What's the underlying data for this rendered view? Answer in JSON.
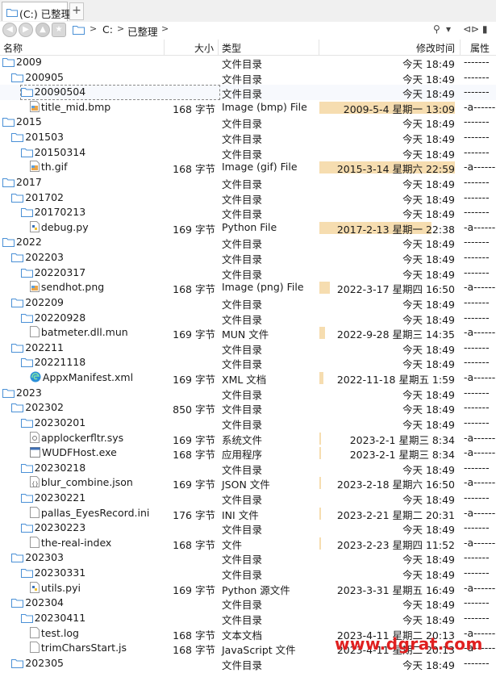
{
  "tab": {
    "title": "(C:) 已整理",
    "new_tab_label": "+"
  },
  "breadcrumb": {
    "items": [
      "C:",
      "已整理"
    ],
    "separator": ">"
  },
  "nav_right": {
    "search_glyph": "⚲",
    "dropdown_glyph": "▾",
    "misc_glyph": "⊲⊳ ▮"
  },
  "columns": {
    "name": "名称",
    "size": "大小",
    "type": "类型",
    "modified": "修改时间",
    "attr": "属性"
  },
  "colors": {
    "date_highlight": "#f6ddb0",
    "folder": "#4a90d6",
    "watermark": "#e02020"
  },
  "rows": [
    {
      "name": "2009",
      "level": 0,
      "icon": "folder",
      "size": "",
      "type": "文件目录",
      "date": "今天  18:49",
      "hl": 0,
      "attr": "-------"
    },
    {
      "name": "200905",
      "level": 1,
      "icon": "folder",
      "size": "",
      "type": "文件目录",
      "date": "今天  18:49",
      "hl": 0,
      "attr": "-------"
    },
    {
      "name": "20090504",
      "level": 2,
      "icon": "folder",
      "size": "",
      "type": "文件目录",
      "date": "今天  18:49",
      "hl": 0,
      "attr": "-------"
    },
    {
      "name": "title_mid.bmp",
      "level": 3,
      "icon": "image",
      "size": "168 字节",
      "type": "Image (bmp) File",
      "date": "2009-5-4 星期一  13:09",
      "hl": 1,
      "attr": "-a------"
    },
    {
      "name": "2015",
      "level": 0,
      "icon": "folder",
      "size": "",
      "type": "文件目录",
      "date": "今天  18:49",
      "hl": 0,
      "attr": "-------"
    },
    {
      "name": "201503",
      "level": 1,
      "icon": "folder",
      "size": "",
      "type": "文件目录",
      "date": "今天  18:49",
      "hl": 0,
      "attr": "-------"
    },
    {
      "name": "20150314",
      "level": 2,
      "icon": "folder",
      "size": "",
      "type": "文件目录",
      "date": "今天  18:49",
      "hl": 0,
      "attr": "-------"
    },
    {
      "name": "th.gif",
      "level": 3,
      "icon": "image",
      "size": "168 字节",
      "type": "Image (gif) File",
      "date": "2015-3-14 星期六  22:59",
      "hl": 1,
      "attr": "-a------"
    },
    {
      "name": "2017",
      "level": 0,
      "icon": "folder",
      "size": "",
      "type": "文件目录",
      "date": "今天  18:49",
      "hl": 0,
      "attr": "-------"
    },
    {
      "name": "201702",
      "level": 1,
      "icon": "folder",
      "size": "",
      "type": "文件目录",
      "date": "今天  18:49",
      "hl": 0,
      "attr": "-------"
    },
    {
      "name": "20170213",
      "level": 2,
      "icon": "folder",
      "size": "",
      "type": "文件目录",
      "date": "今天  18:49",
      "hl": 0,
      "attr": "-------"
    },
    {
      "name": "debug.py",
      "level": 3,
      "icon": "python",
      "size": "169 字节",
      "type": "Python File",
      "date": "2017-2-13 星期一  22:38",
      "hl": 0.83,
      "attr": "-a------"
    },
    {
      "name": "2022",
      "level": 0,
      "icon": "folder",
      "size": "",
      "type": "文件目录",
      "date": "今天  18:49",
      "hl": 0,
      "attr": "-------"
    },
    {
      "name": "202203",
      "level": 1,
      "icon": "folder",
      "size": "",
      "type": "文件目录",
      "date": "今天  18:49",
      "hl": 0,
      "attr": "-------"
    },
    {
      "name": "20220317",
      "level": 2,
      "icon": "folder",
      "size": "",
      "type": "文件目录",
      "date": "今天  18:49",
      "hl": 0,
      "attr": "-------"
    },
    {
      "name": "sendhot.png",
      "level": 3,
      "icon": "image",
      "size": "168 字节",
      "type": "Image (png) File",
      "date": "2022-3-17 星期四  16:50",
      "hl": 0.08,
      "attr": "-a------"
    },
    {
      "name": "202209",
      "level": 1,
      "icon": "folder",
      "size": "",
      "type": "文件目录",
      "date": "今天  18:49",
      "hl": 0,
      "attr": "-------"
    },
    {
      "name": "20220928",
      "level": 2,
      "icon": "folder",
      "size": "",
      "type": "文件目录",
      "date": "今天  18:49",
      "hl": 0,
      "attr": "-------"
    },
    {
      "name": "batmeter.dll.mun",
      "level": 3,
      "icon": "file",
      "size": "169 字节",
      "type": "MUN 文件",
      "date": "2022-9-28 星期三  14:35",
      "hl": 0.04,
      "attr": "-a------"
    },
    {
      "name": "202211",
      "level": 1,
      "icon": "folder",
      "size": "",
      "type": "文件目录",
      "date": "今天  18:49",
      "hl": 0,
      "attr": "-------"
    },
    {
      "name": "20221118",
      "level": 2,
      "icon": "folder",
      "size": "",
      "type": "文件目录",
      "date": "今天  18:49",
      "hl": 0,
      "attr": "-------"
    },
    {
      "name": "AppxManifest.xml",
      "level": 3,
      "icon": "edge",
      "size": "169 字节",
      "type": "XML 文档",
      "date": "2022-11-18 星期五  1:59",
      "hl": 0.03,
      "attr": "-a------"
    },
    {
      "name": "2023",
      "level": 0,
      "icon": "folder",
      "size": "",
      "type": "文件目录",
      "date": "今天  18:49",
      "hl": 0,
      "attr": "-------"
    },
    {
      "name": "202302",
      "level": 1,
      "icon": "folder",
      "size": "850 字节",
      "type": "文件目录",
      "date": "今天  18:49",
      "hl": 0,
      "attr": "-------"
    },
    {
      "name": "20230201",
      "level": 2,
      "icon": "folder",
      "size": "",
      "type": "文件目录",
      "date": "今天  18:49",
      "hl": 0,
      "attr": "-------"
    },
    {
      "name": "applockerfltr.sys",
      "level": 3,
      "icon": "sys",
      "size": "169 字节",
      "type": "系统文件",
      "date": "2023-2-1 星期三  8:34",
      "hl": 0.01,
      "attr": "-a------"
    },
    {
      "name": "WUDFHost.exe",
      "level": 3,
      "icon": "exe",
      "size": "168 字节",
      "type": "应用程序",
      "date": "2023-2-1 星期三  8:34",
      "hl": 0.01,
      "attr": "-a------"
    },
    {
      "name": "20230218",
      "level": 2,
      "icon": "folder",
      "size": "",
      "type": "文件目录",
      "date": "今天  18:49",
      "hl": 0,
      "attr": "-------"
    },
    {
      "name": "blur_combine.json",
      "level": 3,
      "icon": "json",
      "size": "169 字节",
      "type": "JSON 文件",
      "date": "2023-2-18 星期六  16:50",
      "hl": 0.01,
      "attr": "-a------"
    },
    {
      "name": "20230221",
      "level": 2,
      "icon": "folder",
      "size": "",
      "type": "文件目录",
      "date": "今天  18:49",
      "hl": 0,
      "attr": "-------"
    },
    {
      "name": "pallas_EyesRecord.ini",
      "level": 3,
      "icon": "file",
      "size": "176 字节",
      "type": "INI 文件",
      "date": "2023-2-21 星期二  20:31",
      "hl": 0.01,
      "attr": "-a------"
    },
    {
      "name": "20230223",
      "level": 2,
      "icon": "folder",
      "size": "",
      "type": "文件目录",
      "date": "今天  18:49",
      "hl": 0,
      "attr": "-------"
    },
    {
      "name": "the-real-index",
      "level": 3,
      "icon": "file",
      "size": "168 字节",
      "type": "文件",
      "date": "2023-2-23 星期四  11:52",
      "hl": 0.01,
      "attr": "-a------"
    },
    {
      "name": "202303",
      "level": 1,
      "icon": "folder",
      "size": "",
      "type": "文件目录",
      "date": "今天  18:49",
      "hl": 0,
      "attr": "-------"
    },
    {
      "name": "20230331",
      "level": 2,
      "icon": "folder",
      "size": "",
      "type": "文件目录",
      "date": "今天  18:49",
      "hl": 0,
      "attr": "-------"
    },
    {
      "name": "utils.pyi",
      "level": 3,
      "icon": "python",
      "size": "169 字节",
      "type": "Python 源文件",
      "date": "2023-3-31 星期五  16:49",
      "hl": 0,
      "attr": "-a------"
    },
    {
      "name": "202304",
      "level": 1,
      "icon": "folder",
      "size": "",
      "type": "文件目录",
      "date": "今天  18:49",
      "hl": 0,
      "attr": "-------"
    },
    {
      "name": "20230411",
      "level": 2,
      "icon": "folder",
      "size": "",
      "type": "文件目录",
      "date": "今天  18:49",
      "hl": 0,
      "attr": "-------"
    },
    {
      "name": "test.log",
      "level": 3,
      "icon": "file",
      "size": "168 字节",
      "type": "文本文档",
      "date": "2023-4-11 星期二  20:13",
      "hl": 0,
      "attr": "-a------"
    },
    {
      "name": "trimCharsStart.js",
      "level": 3,
      "icon": "file",
      "size": "168 字节",
      "type": "JavaScript 文件",
      "date": "2023-4-11 星期二  20:13",
      "hl": 0,
      "attr": "-a------"
    },
    {
      "name": "202305",
      "level": 1,
      "icon": "folder",
      "size": "",
      "type": "文件目录",
      "date": "今天  18:49",
      "hl": 0,
      "attr": "-------"
    }
  ],
  "watermark": "www.dgrat.com"
}
